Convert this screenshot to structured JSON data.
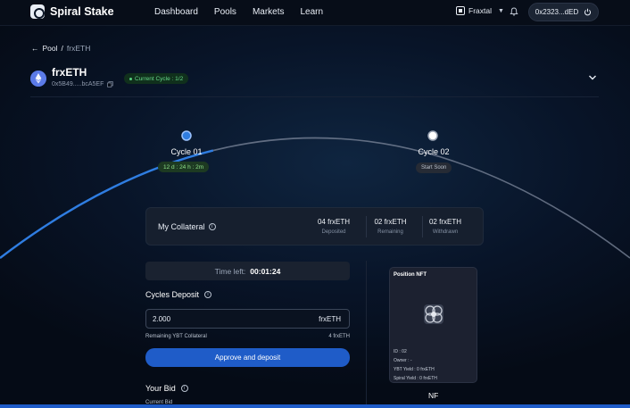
{
  "brand": {
    "name": "Spiral Stake"
  },
  "nav": {
    "dashboard": "Dashboard",
    "pools": "Pools",
    "markets": "Markets",
    "learn": "Learn"
  },
  "chain": {
    "name": "Fraxtal"
  },
  "wallet": {
    "address": "0x2323...dED"
  },
  "breadcrumb": {
    "back": "Pool",
    "separator": "/",
    "current": "frxETH"
  },
  "asset": {
    "name": "frxETH",
    "address": "0x5B49.....bcA5EF",
    "cycle_badge": "Current Cycle : 1/2"
  },
  "cycles": [
    {
      "label": "Cycle 01",
      "status": "12 d : 24 h : 2m",
      "progress": 0.35
    },
    {
      "label": "Cycle 02",
      "status": "Start Soon"
    }
  ],
  "collateral": {
    "title": "My Collateral",
    "stats": [
      {
        "value": "04 frxETH",
        "label": "Deposited"
      },
      {
        "value": "02 frxETH",
        "label": "Remaining"
      },
      {
        "value": "02 frxETH",
        "label": "Withdrawn"
      }
    ]
  },
  "time_left": {
    "label": "Time left:",
    "value": "00:01:24"
  },
  "deposit": {
    "title": "Cycles Deposit",
    "amount": "2.000",
    "unit": "frxETH",
    "remaining_label": "Remaining YBT Collateral",
    "remaining_value": "4 frxETH",
    "button": "Approve and deposit"
  },
  "bid": {
    "title": "Your Bid",
    "current_bid_label": "Current Bid"
  },
  "nft": {
    "title": "Position NFT",
    "id": "ID : 02",
    "owner": "Owner : -",
    "ybt_yield": "YBT Yield : 0 frxETH",
    "spiral_yield": "Spiral Yield : 0 frxETH",
    "footer": "NF"
  },
  "colors": {
    "accent": "#1f5cc8",
    "arc": "#8994a8",
    "arc_progress": "#2f7de1",
    "green": "#66d98a"
  }
}
